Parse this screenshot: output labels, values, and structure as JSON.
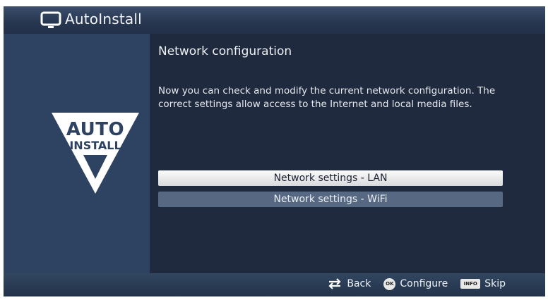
{
  "header": {
    "title": "AutoInstall",
    "icon": "tv-icon"
  },
  "logo": {
    "line1": "AUTO",
    "line2": "INSTALL"
  },
  "content": {
    "title": "Network configuration",
    "description": "Now you can check and modify the current network configuration. The correct settings allow access to the Internet and local media files."
  },
  "menu": {
    "items": [
      {
        "label": "Network settings - LAN",
        "selected": true
      },
      {
        "label": "Network settings - WiFi",
        "selected": false
      }
    ]
  },
  "footer": {
    "back_label": "Back",
    "ok_key": "OK",
    "configure_label": "Configure",
    "info_key": "INFO",
    "skip_label": "Skip"
  },
  "colors": {
    "background": "#1f2a3e",
    "header": "#2e4262",
    "left_panel": "#2e4262",
    "selected_item": "#f0f0f0",
    "unselected_item": "#566882"
  }
}
